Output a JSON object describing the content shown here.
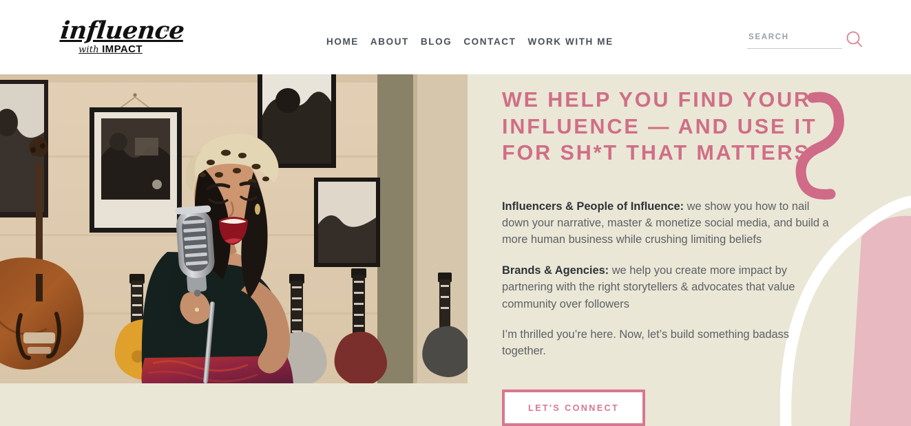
{
  "header": {
    "logo": {
      "script_text": "influence",
      "sub_with": "with ",
      "sub_impact": "IMPACT",
      "trademark": "™"
    },
    "nav": [
      {
        "label": "HOME"
      },
      {
        "label": "ABOUT"
      },
      {
        "label": "BLOG"
      },
      {
        "label": "CONTACT"
      },
      {
        "label": "WORK WITH ME"
      }
    ],
    "search": {
      "placeholder": "SEARCH",
      "value": "",
      "icon": "search-icon"
    }
  },
  "hero": {
    "photo_alt": "woman singing into a vintage microphone in a music shop",
    "title": "WE HELP YOU FIND YOUR INFLUENCE — AND USE IT FOR SH*T THAT MATTERS",
    "paragraphs": [
      {
        "lead": "Influencers & People of Influence:",
        "body": " we show you how to nail down your narrative, master & monetize social media, and build a more human business while crushing limiting beliefs"
      },
      {
        "lead": "Brands & Agencies:",
        "body": " we help you create more impact by partnering with the right storytellers & advocates that value community over followers"
      },
      {
        "lead": "",
        "body": "I’m thrilled you’re here. Now, let’s build something badass together."
      }
    ],
    "cta_label": "LET'S CONNECT"
  },
  "colors": {
    "page_background": "#eae7d6",
    "header_background": "#ffffff",
    "accent_pink": "#d06e87",
    "cta_border_pink": "#d8788f",
    "blob_pink": "#e8b9c0",
    "nav_text": "#49505a",
    "body_text": "#5d6066",
    "lead_text": "#2f3338",
    "decor_white": "#ffffff"
  }
}
